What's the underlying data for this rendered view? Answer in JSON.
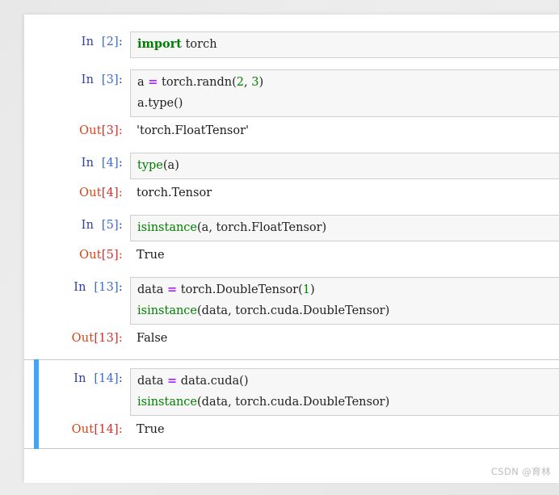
{
  "app": {
    "kind": "jupyter-notebook",
    "background_color": "#ececec",
    "sheet_color": "#ffffff",
    "input_cell_bg": "#f7f7f7",
    "input_cell_border": "#cfcfcf",
    "selected_bar_color": "#42a5f5",
    "in_prompt_color": "#303F9F",
    "in_number_color": "#3d6bd4",
    "out_prompt_color": "#D84315",
    "keyword_color": "#008000",
    "operator_color": "#AA22FF",
    "number_color": "#008000",
    "text_color": "#222222"
  },
  "cells": [
    {
      "id": "cell-2",
      "selected": false,
      "in_prompt": {
        "word": "In",
        "num": "[2]",
        "colon": ":"
      },
      "code_lines": [
        [
          {
            "t": "import",
            "c": "kw"
          },
          {
            "t": " torch",
            "c": "pl"
          }
        ]
      ],
      "output": null
    },
    {
      "id": "cell-3",
      "selected": false,
      "in_prompt": {
        "word": "In",
        "num": "[3]",
        "colon": ":"
      },
      "code_lines": [
        [
          {
            "t": "a ",
            "c": "pl"
          },
          {
            "t": "=",
            "c": "op"
          },
          {
            "t": " torch.randn",
            "c": "pl"
          },
          {
            "t": "(",
            "c": "pl"
          },
          {
            "t": "2",
            "c": "num"
          },
          {
            "t": ", ",
            "c": "pl"
          },
          {
            "t": "3",
            "c": "num"
          },
          {
            "t": ")",
            "c": "pl"
          }
        ],
        [
          {
            "t": "a.type()",
            "c": "pl"
          }
        ]
      ],
      "output": {
        "prompt": {
          "word": "Out",
          "num": "[3]",
          "colon": ":"
        },
        "lines": [
          "'torch.FloatTensor'"
        ]
      }
    },
    {
      "id": "cell-4",
      "selected": false,
      "in_prompt": {
        "word": "In",
        "num": "[4]",
        "colon": ":"
      },
      "code_lines": [
        [
          {
            "t": "type",
            "c": "bi"
          },
          {
            "t": "(a)",
            "c": "pl"
          }
        ]
      ],
      "output": {
        "prompt": {
          "word": "Out",
          "num": "[4]",
          "colon": ":"
        },
        "lines": [
          "torch.Tensor"
        ]
      }
    },
    {
      "id": "cell-5",
      "selected": false,
      "in_prompt": {
        "word": "In",
        "num": "[5]",
        "colon": ":"
      },
      "code_lines": [
        [
          {
            "t": "isinstance",
            "c": "bi"
          },
          {
            "t": "(a, torch.FloatTensor)",
            "c": "pl"
          }
        ]
      ],
      "output": {
        "prompt": {
          "word": "Out",
          "num": "[5]",
          "colon": ":"
        },
        "lines": [
          "True"
        ]
      }
    },
    {
      "id": "cell-13",
      "selected": false,
      "in_prompt": {
        "word": "In",
        "num": "[13]",
        "colon": ":"
      },
      "code_lines": [
        [
          {
            "t": "data ",
            "c": "pl"
          },
          {
            "t": "=",
            "c": "op"
          },
          {
            "t": " torch.DoubleTensor",
            "c": "pl"
          },
          {
            "t": "(",
            "c": "pl"
          },
          {
            "t": "1",
            "c": "num"
          },
          {
            "t": ")",
            "c": "pl"
          }
        ],
        [
          {
            "t": "isinstance",
            "c": "bi"
          },
          {
            "t": "(data, torch.cuda.DoubleTensor)",
            "c": "pl"
          }
        ]
      ],
      "output": {
        "prompt": {
          "word": "Out",
          "num": "[13]",
          "colon": ":"
        },
        "lines": [
          "False"
        ]
      }
    },
    {
      "id": "cell-14",
      "selected": true,
      "in_prompt": {
        "word": "In",
        "num": "[14]",
        "colon": ":"
      },
      "code_lines": [
        [
          {
            "t": "data ",
            "c": "pl"
          },
          {
            "t": "=",
            "c": "op"
          },
          {
            "t": " data.cuda()",
            "c": "pl"
          }
        ],
        [
          {
            "t": "isinstance",
            "c": "bi"
          },
          {
            "t": "(data, torch.cuda.DoubleTensor)",
            "c": "pl"
          }
        ]
      ],
      "output": {
        "prompt": {
          "word": "Out",
          "num": "[14]",
          "colon": ":"
        },
        "lines": [
          "True"
        ]
      }
    }
  ],
  "watermark": {
    "text": "CSDN @育林"
  }
}
